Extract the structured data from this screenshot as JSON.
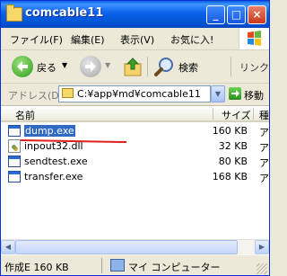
{
  "window": {
    "title": "comcable11"
  },
  "menu": [
    "ファイル(F)",
    "編集(E)",
    "表示(V)",
    "お気に入!"
  ],
  "toolbar": {
    "back_label": "戻る",
    "search_label": "検索",
    "links_label": "リンク"
  },
  "address": {
    "label": "アドレス(D)",
    "path": "C:¥app¥md¥comcable11",
    "go_label": "移動"
  },
  "columns": {
    "name": "名前",
    "size": "サイズ",
    "type": "種"
  },
  "files": [
    {
      "name": "dump.exe",
      "size": "160 KB",
      "type": "ア",
      "icon": "exe-icon",
      "selected": true
    },
    {
      "name": "inpout32.dll",
      "size": "32 KB",
      "type": "ア",
      "icon": "dll-icon",
      "selected": false
    },
    {
      "name": "sendtest.exe",
      "size": "80 KB",
      "type": "ア",
      "icon": "exe-icon",
      "selected": false
    },
    {
      "name": "transfer.exe",
      "size": "168 KB",
      "type": "ア",
      "icon": "exe-icon",
      "selected": false
    }
  ],
  "status": {
    "left": "作成E 160 KB",
    "right": "マイ コンピューター"
  },
  "colors": {
    "titlebar": "#0B61E8",
    "selection": "#316AC5",
    "annotation_underline": "#E0201C"
  }
}
